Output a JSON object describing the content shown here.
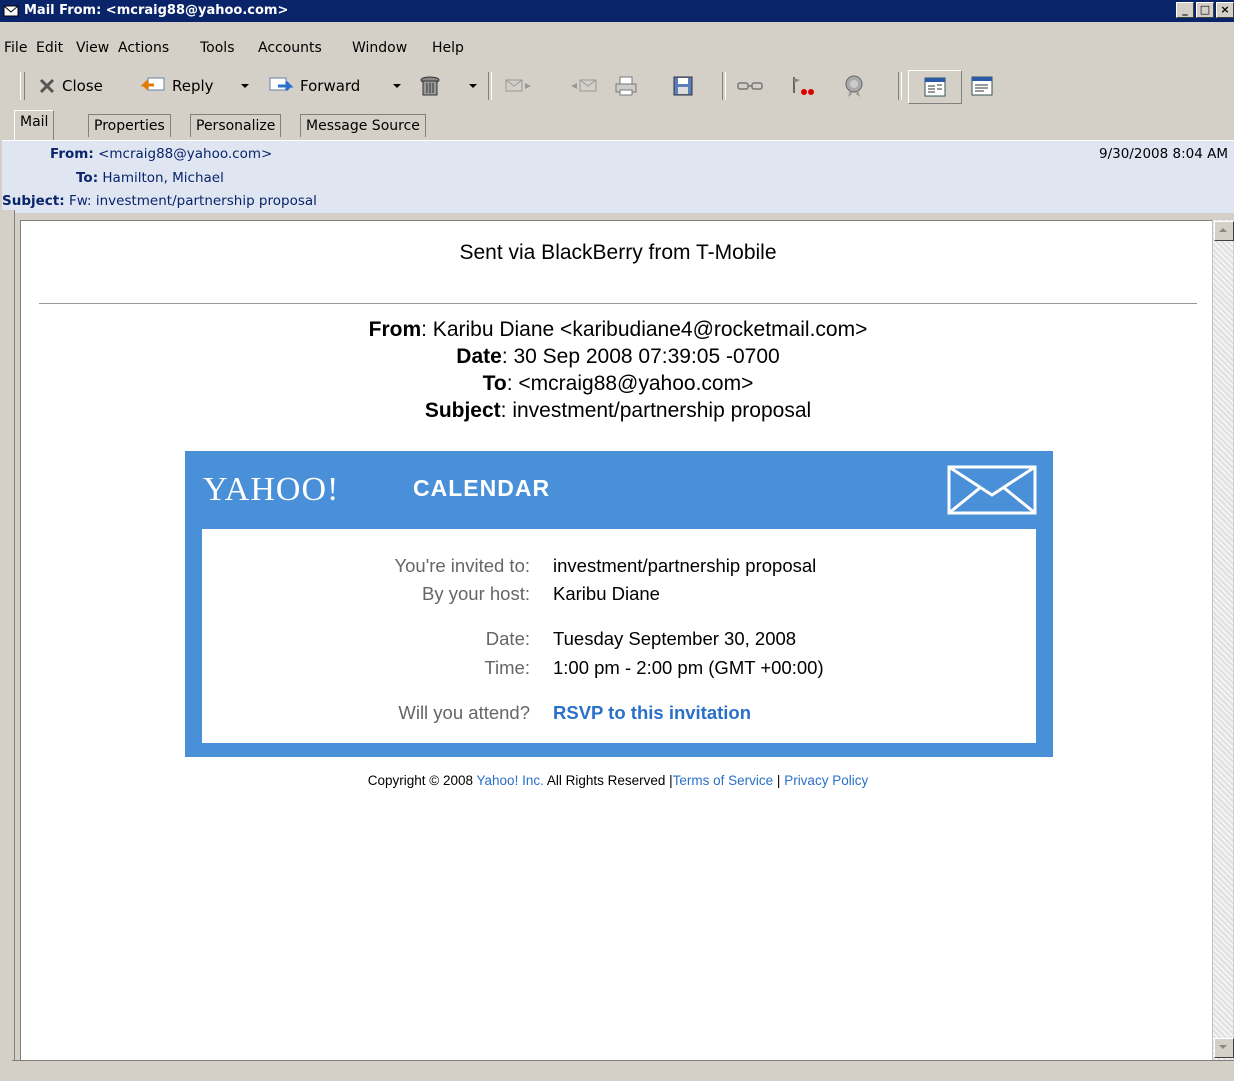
{
  "window": {
    "title": "Mail From: <mcraig88@yahoo.com>",
    "controls": [
      "_",
      "□",
      "×"
    ]
  },
  "menu": [
    "File",
    "Edit",
    "View",
    "Actions",
    "Tools",
    "Accounts",
    "Window",
    "Help"
  ],
  "toolbar": {
    "close_label": "Close",
    "reply_label": "Reply",
    "forward_label": "Forward"
  },
  "tabs": [
    "Mail",
    "Properties",
    "Personalize",
    "Message Source"
  ],
  "header": {
    "from_label": "From:",
    "from_value": "<mcraig88@yahoo.com>",
    "to_label": "To:",
    "to_value": "Hamilton, Michael",
    "subject_label": "Subject:",
    "subject_value": "Fw: investment/partnership proposal",
    "date": "9/30/2008 8:04 AM"
  },
  "message": {
    "sent_via": "Sent via BlackBerry from T-Mobile",
    "fwd_from_label": "From",
    "fwd_from_value": ": Karibu Diane <karibudiane4@rocketmail.com>",
    "fwd_date_label": "Date",
    "fwd_date_value": ": 30 Sep 2008 07:39:05 -0700",
    "fwd_to_label": "To",
    "fwd_to_value": ": <mcraig88@yahoo.com>",
    "fwd_subject_label": "Subject",
    "fwd_subject_value": ": investment/partnership proposal"
  },
  "calendar": {
    "brand": "YAHOO!",
    "brand_suffix": "CALENDAR",
    "invited_label": "You're invited to:",
    "invited_value": "investment/partnership proposal",
    "host_label": "By your host:",
    "host_value": "Karibu Diane",
    "date_label": "Date:",
    "date_value": "Tuesday September 30, 2008",
    "time_label": "Time:",
    "time_value": "1:00 pm - 2:00 pm  (GMT +00:00)",
    "attend_label": "Will you attend?",
    "rsvp_label": "RSVP to this invitation"
  },
  "footer": {
    "copyright": "Copyright © 2008 ",
    "yahoo_link": "Yahoo! Inc.",
    "rights": " All Rights Reserved |",
    "tos_link": "Terms of Service",
    "divider": " | ",
    "privacy_link": "Privacy Policy"
  },
  "colors": {
    "title_bar": "#0a246a",
    "calendar_blue": "#4a90d9",
    "link_blue": "#2a6fc9",
    "header_bg": "#dfe6f2"
  }
}
